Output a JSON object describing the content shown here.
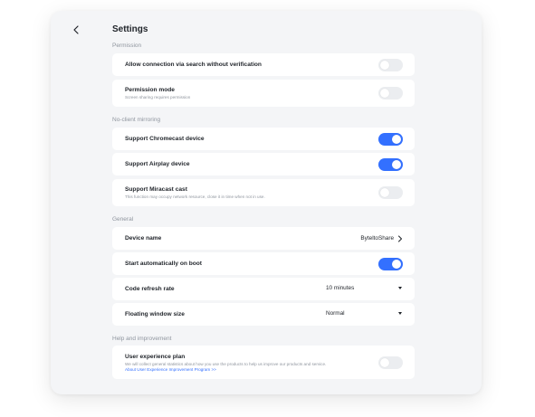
{
  "header": {
    "title": "Settings"
  },
  "sections": {
    "permission": {
      "label": "Permission",
      "connection": {
        "title": "Allow connection via search without verification",
        "enabled": false
      },
      "mode": {
        "title": "Permission mode",
        "desc": "Screen sharing requires permission",
        "enabled": false
      }
    },
    "mirroring": {
      "label": "No-client mirroring",
      "chromecast": {
        "title": "Support Chromecast device",
        "enabled": true
      },
      "airplay": {
        "title": "Support Airplay device",
        "enabled": true
      },
      "miracast": {
        "title": "Support Miracast cast",
        "desc": "This function may occupy network resource, close it in time when not in use.",
        "enabled": false
      }
    },
    "general": {
      "label": "General",
      "device_name": {
        "title": "Device name",
        "value": "ByteltoShare"
      },
      "autostart": {
        "title": "Start automatically on boot",
        "enabled": true
      },
      "refresh": {
        "title": "Code refresh rate",
        "value": "10 minutes"
      },
      "floating": {
        "title": "Floating window size",
        "value": "Normal"
      }
    },
    "help": {
      "label": "Help and improvement",
      "ux_plan": {
        "title": "User experience plan",
        "desc": "We will collect general statistics about how you use the products to help us improve our products and service.",
        "link": "About User Experience Improvement Program >>",
        "enabled": false
      }
    }
  },
  "colors": {
    "accent": "#3370ff",
    "toggle_off": "#ebedf0",
    "background": "#f4f5f7",
    "card": "#ffffff"
  },
  "icons": {
    "back": "chevron-left-icon",
    "device_name": "chevron-right-icon",
    "dropdown": "caret-down-icon"
  }
}
